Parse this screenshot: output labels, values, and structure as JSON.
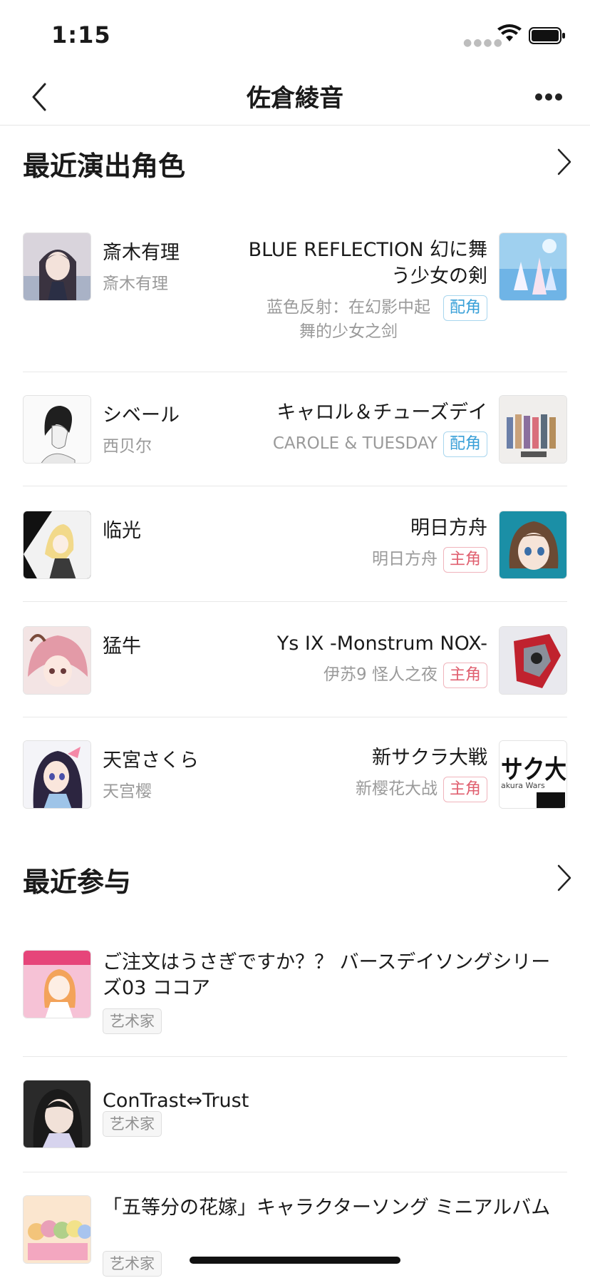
{
  "status_bar": {
    "time": "1:15"
  },
  "nav": {
    "title": "佐倉綾音"
  },
  "roles_section": {
    "title": "最近演出角色",
    "items": [
      {
        "name": "斎木有理",
        "name_sub": "斎木有理",
        "work": "BLUE REFLECTION 幻に舞う少女の剣",
        "work_sub": "蓝色反射：在幻影中起舞的少女之剑",
        "badge": "配角"
      },
      {
        "name": "シベール",
        "name_sub": "西贝尔",
        "work": "キャロル＆チューズデイ",
        "work_sub": "CAROLE & TUESDAY",
        "badge": "配角"
      },
      {
        "name": "临光",
        "name_sub": "",
        "work": "明日方舟",
        "work_sub": "明日方舟",
        "badge": "主角"
      },
      {
        "name": "猛牛",
        "name_sub": "",
        "work": "Ys IX -Monstrum NOX-",
        "work_sub": "伊苏9 怪人之夜",
        "badge": "主角"
      },
      {
        "name": "天宮さくら",
        "name_sub": "天宫樱",
        "work": "新サクラ大戦",
        "work_sub": "新樱花大战",
        "badge": "主角"
      }
    ]
  },
  "participation_section": {
    "title": "最近参与",
    "items": [
      {
        "title": "ご注文はうさぎですか？？ バースデイソングシリーズ03 ココア",
        "tag": "艺术家"
      },
      {
        "title": "ConTrast⇔Trust",
        "tag": "艺术家"
      },
      {
        "title": "「五等分の花嫁」キャラクターソング ミニアルバム",
        "tag": "艺术家"
      }
    ]
  },
  "artwork_labels": {
    "sakura_wars_cover": "サク大",
    "sakura_wars_caption": "akura Wars"
  },
  "colors": {
    "cv_badge": "#39a0d8",
    "main_badge": "#e06070",
    "divider": "#e8e8e8",
    "secondary_text": "#9a9a9a"
  }
}
